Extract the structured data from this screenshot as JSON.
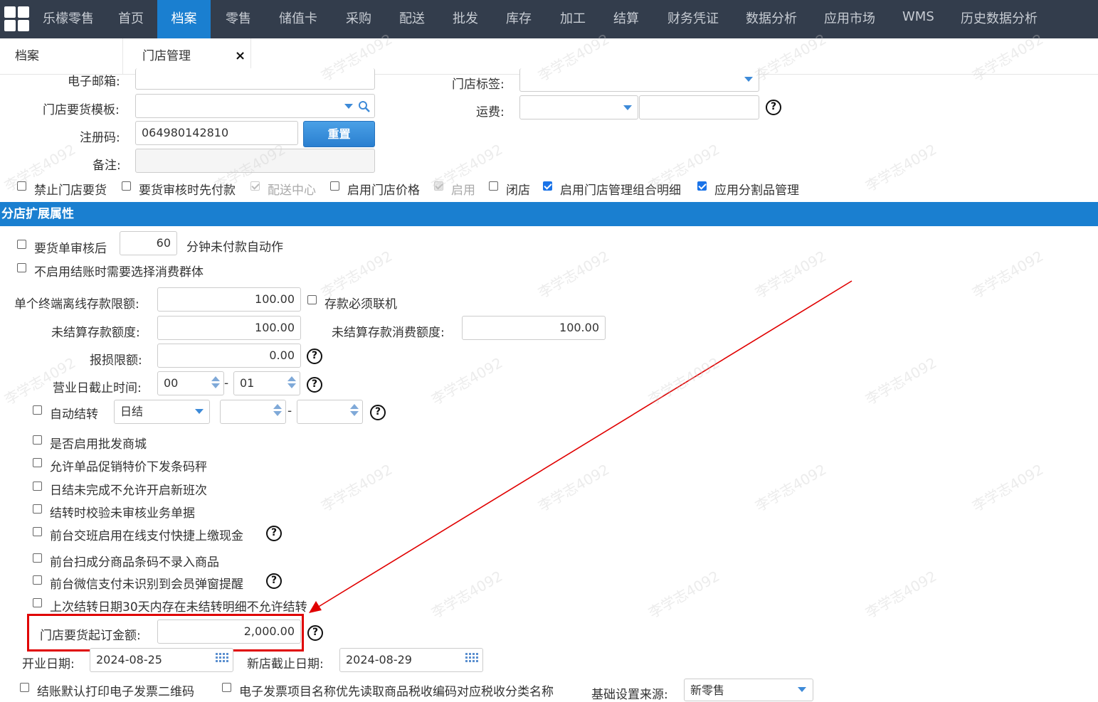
{
  "nav": {
    "app_name": "乐檬零售",
    "items": [
      "首页",
      "档案",
      "零售",
      "储值卡",
      "采购",
      "配送",
      "批发",
      "库存",
      "加工",
      "结算",
      "财务凭证",
      "数据分析",
      "应用市场",
      "WMS",
      "历史数据分析"
    ]
  },
  "tabs": {
    "first": "档案",
    "second": "门店管理",
    "close": "×"
  },
  "form": {
    "email_label": "电子邮箱:",
    "store_tag_label": "门店标签:",
    "order_template_label": "门店要货模板:",
    "freight_label": "运费:",
    "reg_code_label": "注册码:",
    "reg_code_value": "064980142810",
    "reset_button": "重置",
    "remark_label": "备注:",
    "checks": {
      "forbid_order": "禁止门店要货",
      "prepay_on_audit": "要货审核时先付款",
      "dist_center": "配送中心",
      "enable_store_price": "启用门店价格",
      "enable": "启用",
      "closed": "闭店",
      "enable_combo_detail": "启用门店管理组合明细",
      "enable_split_goods": "应用分割品管理"
    }
  },
  "section_title": "分店扩展属性",
  "ext": {
    "order_after_audit": "要货单审核后",
    "minutes_value": "60",
    "minutes_suffix": "分钟未付款自动作",
    "no_consumer_group": "不启用结账时需要选择消费群体",
    "offline_limit_label": "单个终端离线存款限额:",
    "offline_limit_value": "100.00",
    "deposit_online": "存款必须联机",
    "unsettled_deposit_label": "未结算存款额度:",
    "unsettled_deposit_value": "100.00",
    "unsettled_consume_label": "未结算存款消费额度:",
    "unsettled_consume_value": "100.00",
    "loss_limit_label": "报损限额:",
    "loss_limit_value": "0.00",
    "cutoff_label": "营业日截止时间:",
    "cutoff_hour": "00",
    "cutoff_dash": "-",
    "cutoff_min": "01",
    "auto_settle": "自动结转",
    "settle_type": "日结",
    "settle_dash": "-",
    "list": [
      "是否启用批发商城",
      "允许单品促销特价下发条码秤",
      "日结未完成不允许开启新班次",
      "结转时校验未审核业务单据",
      "前台交班启用在线支付快捷上缴现金",
      "前台扫成分商品条码不录入商品",
      "前台微信支付未识别到会员弹窗提醒",
      "上次结转日期30天内存在未结转明细不允许结转"
    ],
    "min_order_label": "门店要货起订金额:",
    "min_order_value": "2,000.00",
    "open_date_label": "开业日期:",
    "open_date_value": "2024-08-25",
    "new_store_end_label": "新店截止日期:",
    "new_store_end_value": "2024-08-29",
    "print_einvoice_qr": "结账默认打印电子发票二维码",
    "einvoice_name_priority": "电子发票项目名称优先读取商品税收编码对应税收分类名称",
    "base_source_label": "基础设置来源:",
    "base_source_value": "新零售"
  },
  "help_glyph": "?",
  "watermark": "李学志4092",
  "colors": {
    "nav_bg": "#333d4c",
    "accent": "#1a7fd0",
    "highlight": "#e00000"
  }
}
